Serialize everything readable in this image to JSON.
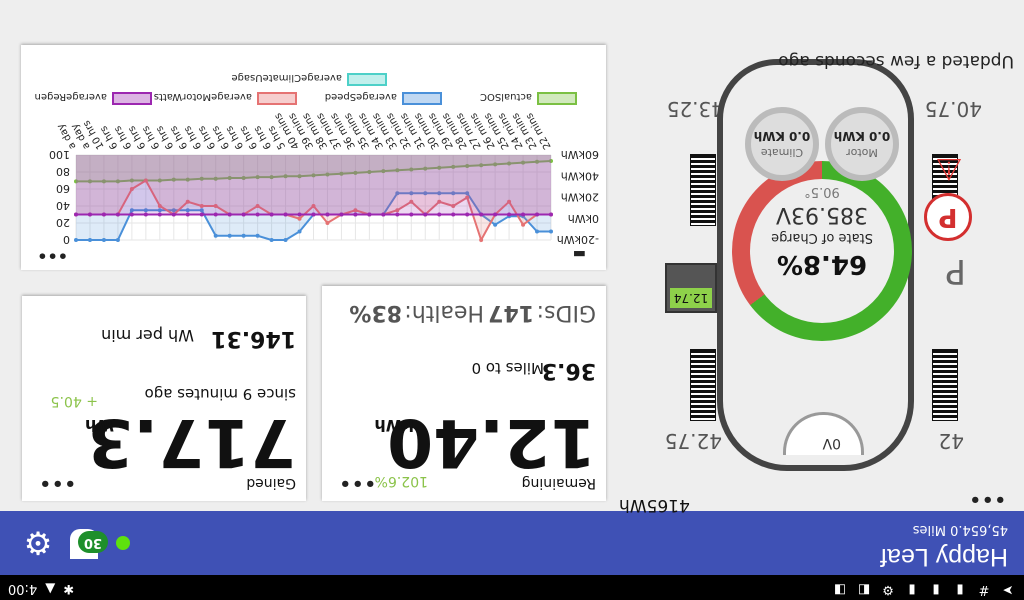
{
  "status_bar": {
    "time": "4:00",
    "icons": [
      "bluetooth-icon",
      "warning-icon",
      "notification-icon"
    ]
  },
  "app_bar": {
    "title": "Happy Leaf",
    "subtitle": "45,654.0 Miles",
    "badge_value": "30",
    "status_color": "#5ee10e",
    "bar_color": "#3f51b5"
  },
  "car": {
    "total_energy": "4165Wh",
    "updated": "Updated a few seconds ago",
    "gear": "P",
    "battery_12v": "12.74",
    "tyres": {
      "front_left": "40.75",
      "front_right": "43.25",
      "rear_left": "42",
      "rear_right": "42.75"
    },
    "motor": {
      "label": "Motor",
      "value": "0.0 KWh"
    },
    "climate": {
      "label": "Climate",
      "value": "0.0 KWh"
    },
    "eco_label": "0V",
    "soc": {
      "percent": "64.8%",
      "label": "State of Charge",
      "wh": "385.93V",
      "sub": "90.5°",
      "level": 0.648
    }
  },
  "cards": {
    "remaining": {
      "label": "Remaining",
      "value": "12.40",
      "unit": "kWh",
      "pct": "102.6%",
      "miles": "36.3",
      "miles_label": "Miles to 0",
      "gids_label": "GIDs:",
      "gids": "147",
      "health_label": "Health:",
      "health": "83%"
    },
    "gained": {
      "label": "Gained",
      "value": "717.3",
      "unit": "Wh",
      "delta": "+ 40.5",
      "since": "since 9 minutes ago",
      "rate": "146.31",
      "rate_unit": "Wh per min"
    }
  },
  "chart_data": {
    "type": "line",
    "legend": [
      "actualSOC",
      "averageSpeed",
      "averageMotorWatts",
      "averageRegen",
      "averageClimateUsage"
    ],
    "legend_colors": [
      "#7bc043",
      "#4a90d9",
      "#e57373",
      "#9c27b0",
      "#4dd0c8"
    ],
    "y_left_ticks": [
      "0",
      "20",
      "40",
      "60",
      "80",
      "100"
    ],
    "y_right_ticks": [
      "-20kWh",
      "0kWh",
      "20kWh",
      "40kWh",
      "60kWh"
    ],
    "categories": [
      "22 mins",
      "23 mins",
      "24 mins",
      "25 mins",
      "26 mins",
      "27 mins",
      "28 mins",
      "29 mins",
      "30 mins",
      "31 mins",
      "32 mins",
      "33 mins",
      "34 mins",
      "35 mins",
      "36 mins",
      "37 mins",
      "38 mins",
      "39 mins",
      "40 mins",
      "5 hrs",
      "6 hrs",
      "6 hrs",
      "6 hrs",
      "6 hrs",
      "6 hrs",
      "6 hrs",
      "6 hrs",
      "6 hrs",
      "6 hrs",
      "6 hrs",
      "6 hrs",
      "6 hrs",
      "10 hrs",
      "a day",
      "a day"
    ],
    "series": [
      {
        "name": "actualSOC",
        "values": [
          93,
          92,
          91,
          90,
          89,
          88,
          87,
          86,
          85,
          84,
          83,
          82,
          81,
          80,
          79,
          78,
          77,
          76,
          75,
          75,
          74,
          74,
          73,
          73,
          72,
          72,
          71,
          71,
          70,
          70,
          70,
          69,
          69,
          69,
          69
        ]
      },
      {
        "name": "averageSpeed",
        "values": [
          10,
          10,
          28,
          28,
          18,
          30,
          55,
          55,
          55,
          55,
          55,
          55,
          30,
          30,
          30,
          30,
          30,
          30,
          10,
          0,
          0,
          5,
          5,
          5,
          5,
          35,
          35,
          35,
          35,
          35,
          35,
          0,
          0,
          0,
          0
        ]
      },
      {
        "name": "averageMotorWatts",
        "values": [
          30,
          30,
          18,
          45,
          30,
          0,
          50,
          40,
          45,
          30,
          45,
          35,
          30,
          30,
          35,
          30,
          20,
          40,
          25,
          30,
          30,
          40,
          30,
          30,
          40,
          40,
          45,
          30,
          40,
          70,
          60,
          30,
          30,
          30,
          30
        ]
      },
      {
        "name": "averageRegen",
        "values": [
          30,
          30,
          30,
          30,
          30,
          30,
          30,
          30,
          30,
          30,
          30,
          30,
          30,
          30,
          30,
          30,
          30,
          30,
          30,
          30,
          30,
          30,
          30,
          30,
          30,
          30,
          30,
          30,
          30,
          30,
          30,
          30,
          30,
          30,
          30
        ]
      }
    ]
  }
}
